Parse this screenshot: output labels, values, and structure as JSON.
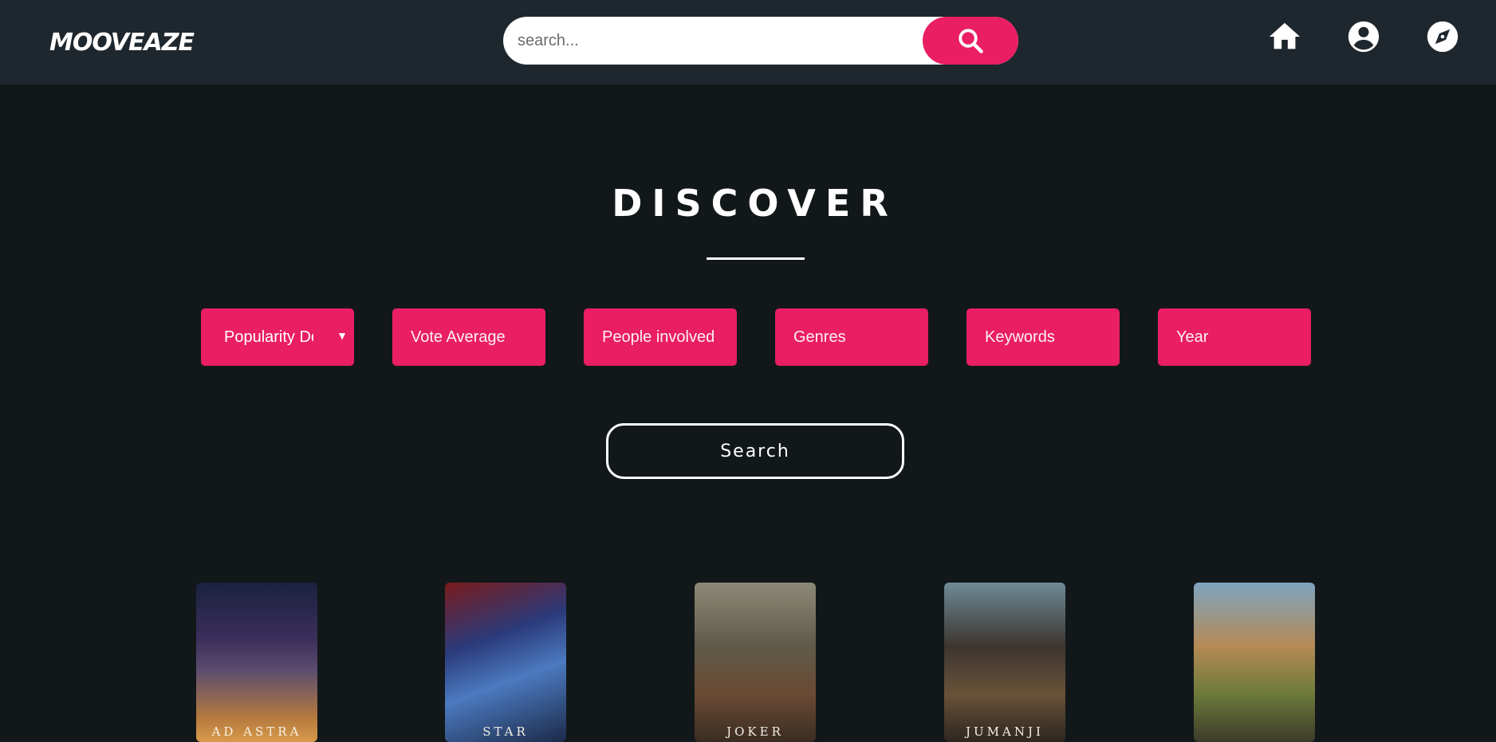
{
  "header": {
    "logo": "MOOVEAZE",
    "search": {
      "placeholder": "search...",
      "value": ""
    },
    "nav_icons": [
      "home-icon",
      "account-circle-icon",
      "explore-compass-icon"
    ]
  },
  "discover": {
    "title": "DISCOVER",
    "filters": {
      "sort": "Popularity De",
      "vote_average": "Vote Average",
      "people": "People involved",
      "genres": "Genres",
      "keywords": "Keywords",
      "year": "Year"
    },
    "search_button": "Search"
  },
  "posters": [
    {
      "title": "AD ASTRA"
    },
    {
      "title": "STAR"
    },
    {
      "title": "JOKER"
    },
    {
      "title": "JUMANJI"
    },
    {
      "title": ""
    }
  ],
  "colors": {
    "accent": "#e91e63",
    "header_bg": "#1f272e",
    "page_bg": "#121819",
    "text": "#ffffff"
  }
}
